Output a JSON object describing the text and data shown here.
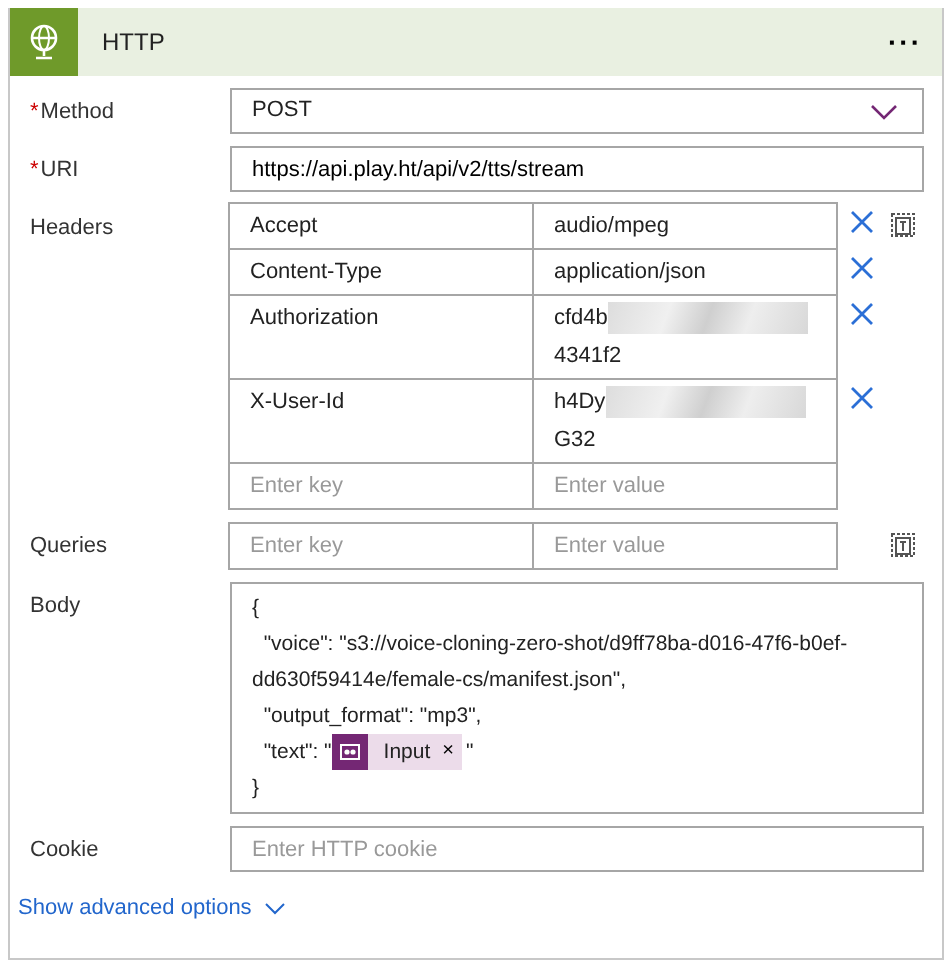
{
  "card": {
    "title": "HTTP",
    "menu": "···"
  },
  "method": {
    "label": "Method",
    "required_mark": "*",
    "value": "POST"
  },
  "uri": {
    "label": "URI",
    "required_mark": "*",
    "value": "https://api.play.ht/api/v2/tts/stream"
  },
  "headers": {
    "label": "Headers",
    "rows": [
      {
        "key": "Accept",
        "value": [
          "audio/mpeg"
        ],
        "redacted": false
      },
      {
        "key": "Content-Type",
        "value": [
          "application/json"
        ],
        "redacted": false
      },
      {
        "key": "Authorization",
        "value": [
          "cfd4b",
          "4341f2"
        ],
        "redacted": true
      },
      {
        "key": "X-User-Id",
        "value": [
          "h4Dy",
          "G32"
        ],
        "redacted": true
      }
    ],
    "key_placeholder": "Enter key",
    "value_placeholder": "Enter value"
  },
  "queries": {
    "label": "Queries",
    "key_placeholder": "Enter key",
    "value_placeholder": "Enter value"
  },
  "body": {
    "label": "Body",
    "lines": [
      {
        "kind": "text",
        "text": "{"
      },
      {
        "kind": "text",
        "text": "  \"voice\": \"s3://voice-cloning-zero-shot/d9ff78ba-d016-47f6-b0ef-"
      },
      {
        "kind": "text",
        "text": "dd630f59414e/female-cs/manifest.json\","
      },
      {
        "kind": "text",
        "text": "  \"output_format\": \"mp3\","
      },
      {
        "kind": "token",
        "before": "  \"text\": \"",
        "token": "Input",
        "close": "×",
        "after": "\""
      },
      {
        "kind": "text",
        "text": "}"
      }
    ]
  },
  "cookie": {
    "label": "Cookie",
    "placeholder": "Enter HTTP cookie"
  },
  "advanced": {
    "label": "Show advanced options"
  }
}
